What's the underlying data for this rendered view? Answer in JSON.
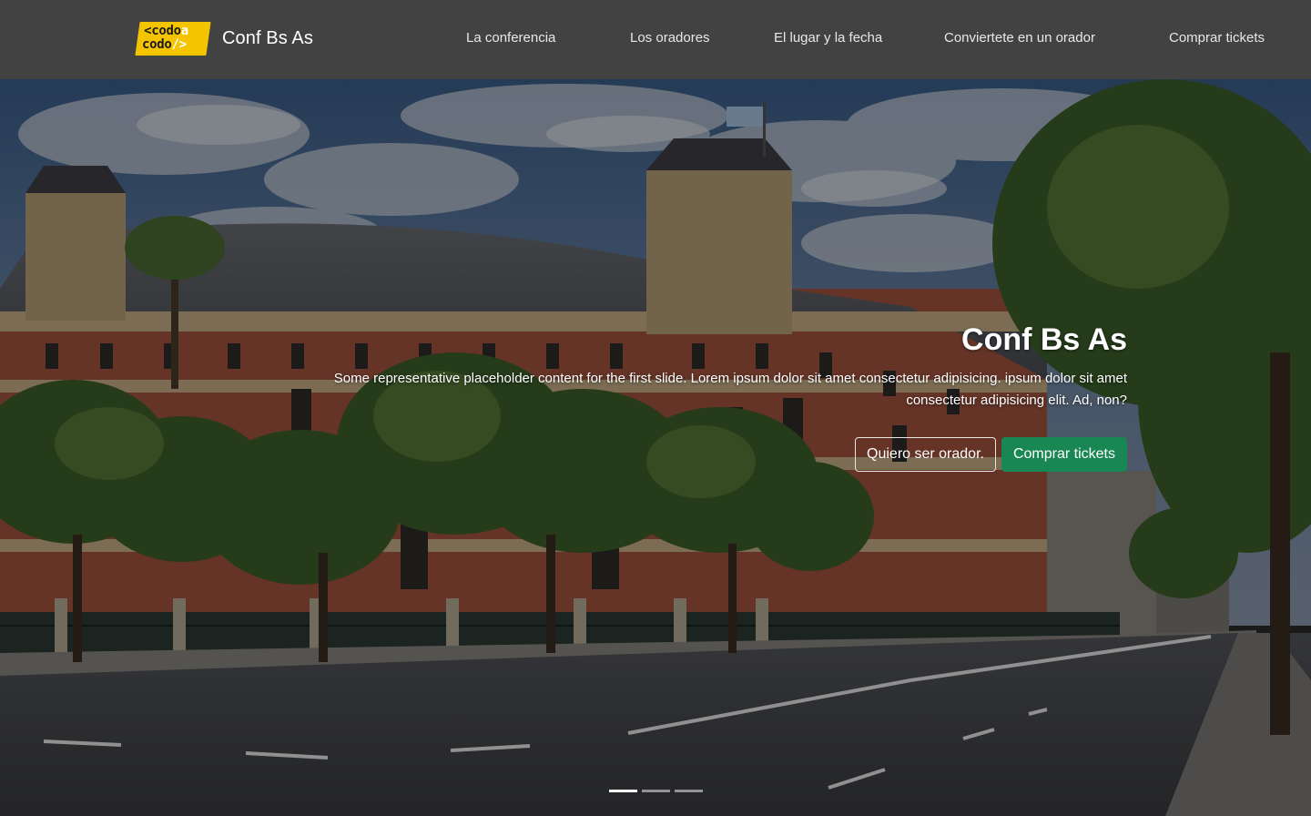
{
  "brand": {
    "logo_line1": "<codo",
    "logo_line1_accent": "a",
    "logo_line2": "codo",
    "logo_line2_accent": "/>",
    "name": "Conf Bs As"
  },
  "nav": {
    "items": [
      {
        "label": "La conferencia"
      },
      {
        "label": "Los oradores"
      },
      {
        "label": "El lugar y la fecha"
      },
      {
        "label": "Conviertete en un orador"
      },
      {
        "label": "Comprar tickets"
      }
    ]
  },
  "hero": {
    "title": "Conf Bs As",
    "text": "Some representative placeholder content for the first slide. Lorem ipsum dolor sit amet consectetur adipisicing. ipsum dolor sit amet consectetur adipisicing elit. Ad, non?",
    "btn_speaker": "Quiero ser orador.",
    "btn_tickets": "Comprar tickets",
    "slides_total": 3,
    "active_slide": 1
  },
  "colors": {
    "navbar": "#424242",
    "logo_yellow": "#f5c400",
    "success": "#198754"
  }
}
